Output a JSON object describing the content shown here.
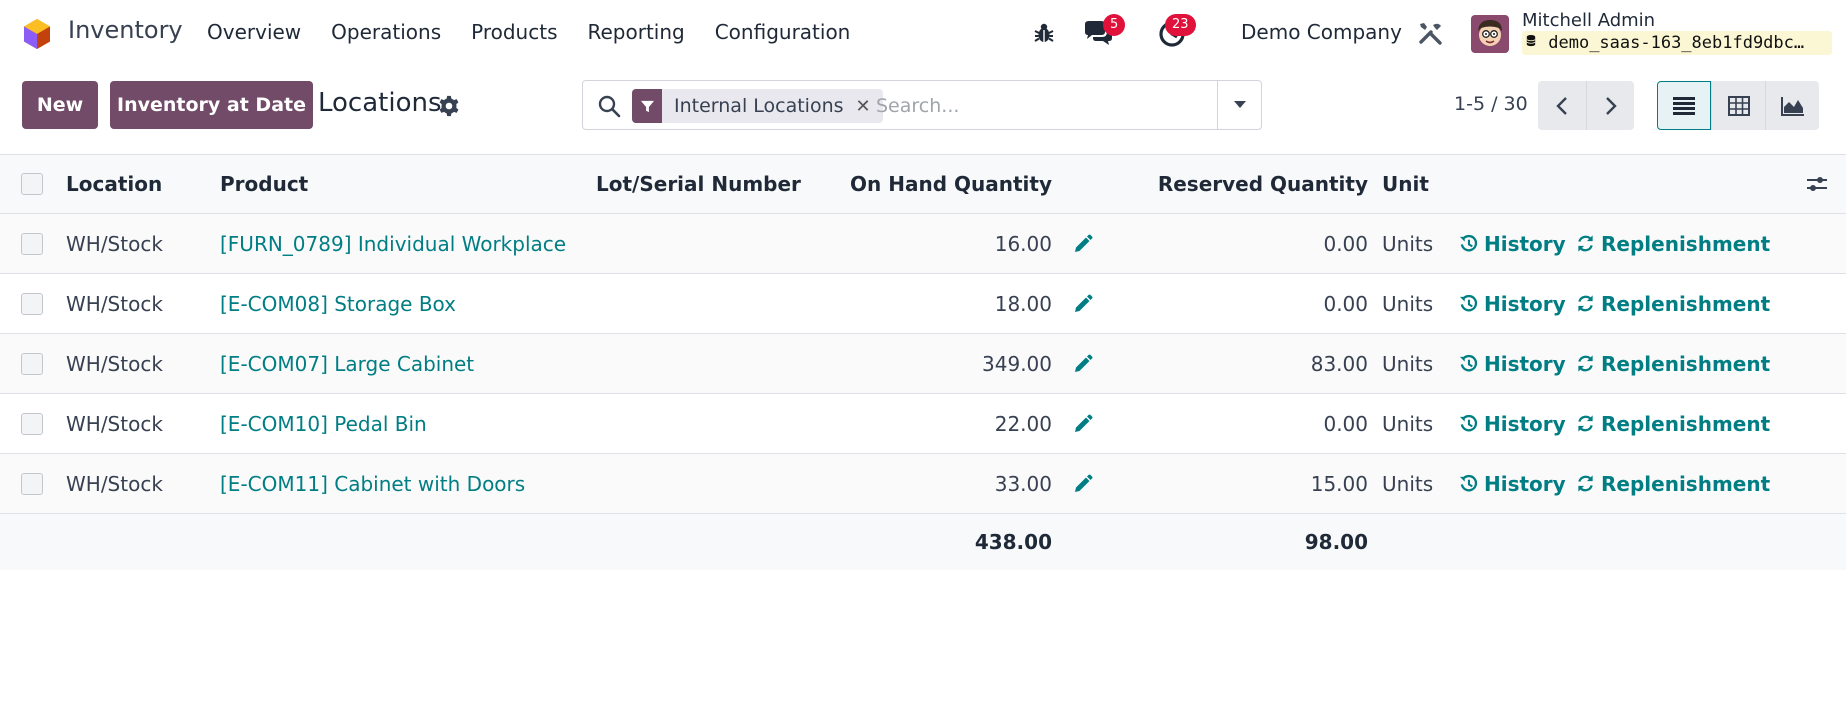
{
  "navbar": {
    "app_name": "Inventory",
    "menu": [
      "Overview",
      "Operations",
      "Products",
      "Reporting",
      "Configuration"
    ],
    "messages_count": "5",
    "activities_count": "23",
    "company": "Demo Company",
    "user_name": "Mitchell Admin",
    "database": "demo_saas-163_8eb1fd9dbc…"
  },
  "control_panel": {
    "new_label": "New",
    "inventory_at_date_label": "Inventory at Date",
    "breadcrumb": "Locations",
    "search": {
      "facet": "Internal Locations",
      "placeholder": "Search..."
    },
    "pager": "1-5 / 30"
  },
  "table": {
    "columns": {
      "location": "Location",
      "product": "Product",
      "lot": "Lot/Serial Number",
      "on_hand": "On Hand Quantity",
      "reserved": "Reserved Quantity",
      "unit": "Unit"
    },
    "history_label": "History",
    "replenishment_label": "Replenishment",
    "rows": [
      {
        "location": "WH/Stock",
        "product": "[FURN_0789] Individual Workplace",
        "lot": "",
        "on_hand": "16.00",
        "reserved": "0.00",
        "unit": "Units"
      },
      {
        "location": "WH/Stock",
        "product": "[E-COM08] Storage Box",
        "lot": "",
        "on_hand": "18.00",
        "reserved": "0.00",
        "unit": "Units"
      },
      {
        "location": "WH/Stock",
        "product": "[E-COM07] Large Cabinet",
        "lot": "",
        "on_hand": "349.00",
        "reserved": "83.00",
        "unit": "Units"
      },
      {
        "location": "WH/Stock",
        "product": "[E-COM10] Pedal Bin",
        "lot": "",
        "on_hand": "22.00",
        "reserved": "0.00",
        "unit": "Units"
      },
      {
        "location": "WH/Stock",
        "product": "[E-COM11] Cabinet with Doors",
        "lot": "",
        "on_hand": "33.00",
        "reserved": "15.00",
        "unit": "Units"
      }
    ],
    "totals": {
      "on_hand": "438.00",
      "reserved": "98.00"
    }
  },
  "colors": {
    "brand": "#714b67",
    "link": "#017e84",
    "badge": "#e0123b"
  }
}
